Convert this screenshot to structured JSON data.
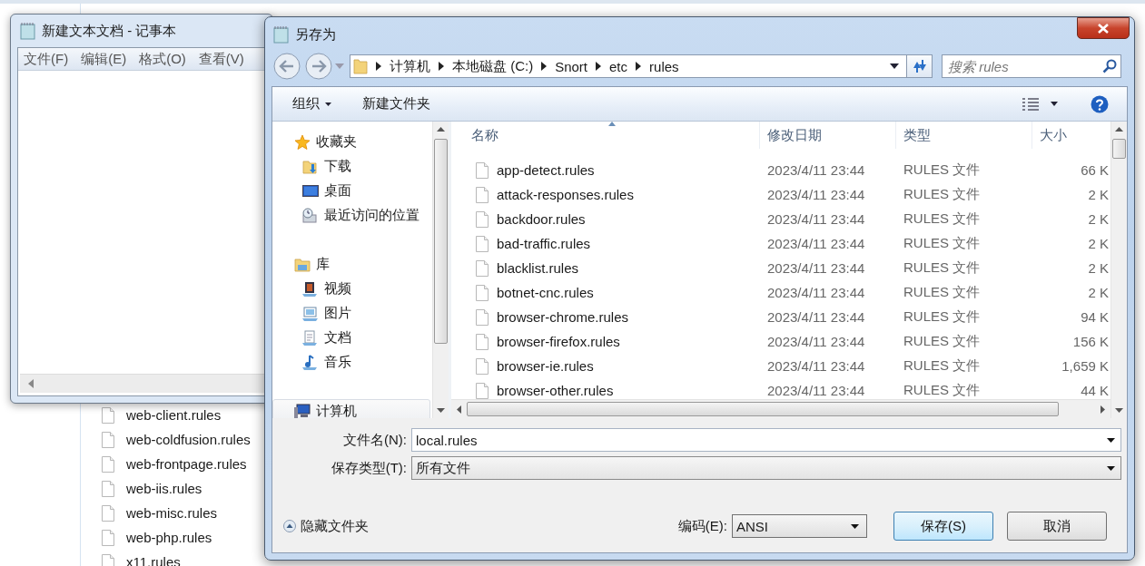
{
  "background_explorer": {
    "rows": [
      {
        "name": "web-client.rules"
      },
      {
        "name": "web-coldfusion.rules"
      },
      {
        "name": "web-frontpage.rules"
      },
      {
        "name": "web-iis.rules"
      },
      {
        "name": "web-misc.rules"
      },
      {
        "name": "web-php.rules"
      },
      {
        "name": "x11.rules"
      }
    ]
  },
  "notepad": {
    "title": "新建文本文档 - 记事本",
    "menu": [
      "文件(F)",
      "编辑(E)",
      "格式(O)",
      "查看(V)"
    ]
  },
  "dialog": {
    "title": "另存为",
    "address": {
      "path": [
        "计算机",
        "本地磁盘 (C:)",
        "Snort",
        "etc",
        "rules"
      ],
      "search_placeholder": "搜索 rules"
    },
    "toolbar": {
      "organize": "组织",
      "new_folder": "新建文件夹"
    },
    "sidebar": {
      "items": [
        {
          "label": "收藏夹",
          "selected": false,
          "children": [
            {
              "label": "下载",
              "selected": false
            },
            {
              "label": "桌面",
              "selected": false
            },
            {
              "label": "最近访问的位置",
              "selected": false
            }
          ]
        },
        {
          "label": "库",
          "selected": false,
          "children": [
            {
              "label": "视频",
              "selected": false
            },
            {
              "label": "图片",
              "selected": false
            },
            {
              "label": "文档",
              "selected": false
            },
            {
              "label": "音乐",
              "selected": false
            }
          ]
        },
        {
          "label": "计算机",
          "selected": true
        }
      ]
    },
    "table": {
      "columns": [
        {
          "label": "名称",
          "sorted": true
        },
        {
          "label": "修改日期",
          "sorted": false
        },
        {
          "label": "类型",
          "sorted": false
        },
        {
          "label": "大小",
          "sorted": false
        }
      ],
      "rows": [
        {
          "name": "app-detect.rules",
          "date": "2023/4/11 23:44",
          "type": "RULES 文件",
          "size": "66 K"
        },
        {
          "name": "attack-responses.rules",
          "date": "2023/4/11 23:44",
          "type": "RULES 文件",
          "size": "2 K"
        },
        {
          "name": "backdoor.rules",
          "date": "2023/4/11 23:44",
          "type": "RULES 文件",
          "size": "2 K"
        },
        {
          "name": "bad-traffic.rules",
          "date": "2023/4/11 23:44",
          "type": "RULES 文件",
          "size": "2 K"
        },
        {
          "name": "blacklist.rules",
          "date": "2023/4/11 23:44",
          "type": "RULES 文件",
          "size": "2 K"
        },
        {
          "name": "botnet-cnc.rules",
          "date": "2023/4/11 23:44",
          "type": "RULES 文件",
          "size": "2 K"
        },
        {
          "name": "browser-chrome.rules",
          "date": "2023/4/11 23:44",
          "type": "RULES 文件",
          "size": "94 K"
        },
        {
          "name": "browser-firefox.rules",
          "date": "2023/4/11 23:44",
          "type": "RULES 文件",
          "size": "156 K"
        },
        {
          "name": "browser-ie.rules",
          "date": "2023/4/11 23:44",
          "type": "RULES 文件",
          "size": "1,659 K"
        },
        {
          "name": "browser-other.rules",
          "date": "2023/4/11 23:44",
          "type": "RULES 文件",
          "size": "44 K"
        }
      ]
    },
    "filename": {
      "label": "文件名(N):",
      "value": "local.rules"
    },
    "save_type": {
      "label": "保存类型(T):",
      "value": "所有文件"
    },
    "hide_folders": "隐藏文件夹",
    "encoding": {
      "label": "编码(E):",
      "value": "ANSI"
    },
    "buttons": [
      {
        "label": "保存(S)",
        "default": true
      },
      {
        "label": "取消",
        "default": false
      }
    ]
  }
}
